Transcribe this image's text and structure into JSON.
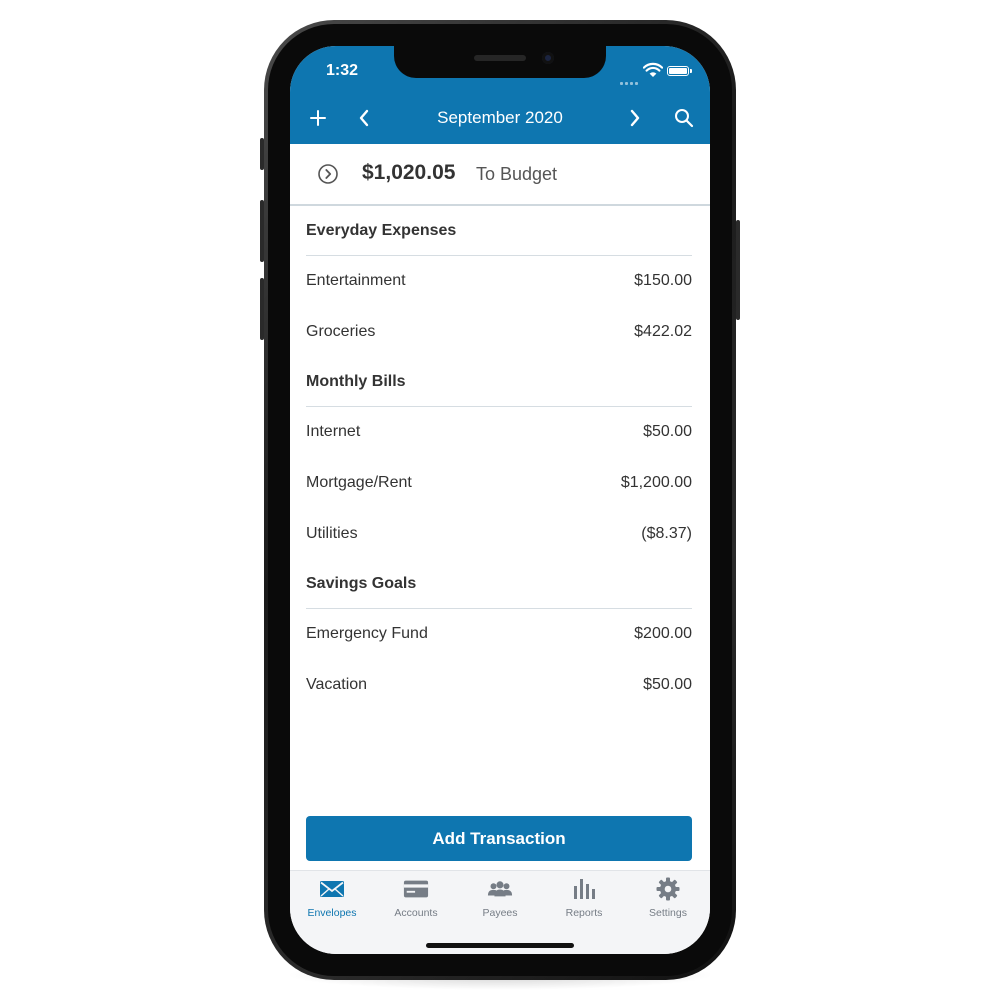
{
  "status_bar": {
    "time": "1:32"
  },
  "nav": {
    "title": "September 2020"
  },
  "budget": {
    "amount": "$1,020.05",
    "label": "To Budget"
  },
  "groups": [
    {
      "name": "Everyday Expenses",
      "items": [
        {
          "name": "Entertainment",
          "amount": "$150.00"
        },
        {
          "name": "Groceries",
          "amount": "$422.02"
        }
      ]
    },
    {
      "name": "Monthly Bills",
      "items": [
        {
          "name": "Internet",
          "amount": "$50.00"
        },
        {
          "name": "Mortgage/Rent",
          "amount": "$1,200.00"
        },
        {
          "name": "Utilities",
          "amount": "($8.37)"
        }
      ]
    },
    {
      "name": "Savings Goals",
      "items": [
        {
          "name": "Emergency Fund",
          "amount": "$200.00"
        },
        {
          "name": "Vacation",
          "amount": "$50.00"
        }
      ]
    }
  ],
  "add_button": {
    "label": "Add Transaction"
  },
  "tabs": [
    {
      "label": "Envelopes",
      "icon": "envelope-icon",
      "active": true
    },
    {
      "label": "Accounts",
      "icon": "credit-card-icon",
      "active": false
    },
    {
      "label": "Payees",
      "icon": "people-icon",
      "active": false
    },
    {
      "label": "Reports",
      "icon": "bar-chart-icon",
      "active": false
    },
    {
      "label": "Settings",
      "icon": "gear-icon",
      "active": false
    }
  ],
  "colors": {
    "accent": "#0e76b0",
    "inactive_tab": "#767d86",
    "text": "#333333"
  }
}
